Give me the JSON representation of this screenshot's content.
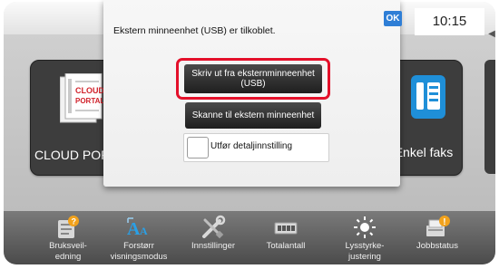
{
  "dialog": {
    "message": "Ekstern minneenhet (USB) er tilkoblet.",
    "ok_label": "OK",
    "print_usb_label": "Skriv ut fra eksternminneenhet (USB)",
    "scan_label": "Skanne til ekstern minneenhet",
    "detail_setting_label": "Utfør detaljinnstilling",
    "detail_setting_checked": false,
    "highlight_color": "#e4102a"
  },
  "status": {
    "time": "10:15"
  },
  "tiles": {
    "cloud_portal": {
      "logo_line1": "CLOUD",
      "logo_line2": "PORTAL",
      "label": "CLOUD POR"
    },
    "simple_fax": {
      "label": "Enkel faks"
    }
  },
  "pager": {
    "page_count": 4,
    "active_index": 0,
    "active_color": "#2d8ee0"
  },
  "bottom_nav": [
    {
      "label": "Bruksveil-\nedning",
      "icon": "manual-icon"
    },
    {
      "label": "Forstørr\nvisningsmodus",
      "icon": "magnify-text-icon"
    },
    {
      "label": "Innstillinger",
      "icon": "tools-icon"
    },
    {
      "label": "Totalantall",
      "icon": "counter-icon"
    },
    {
      "label": "Lysstyrke-\njustering",
      "icon": "brightness-icon"
    },
    {
      "label": "Jobbstatus",
      "icon": "job-status-icon"
    }
  ]
}
